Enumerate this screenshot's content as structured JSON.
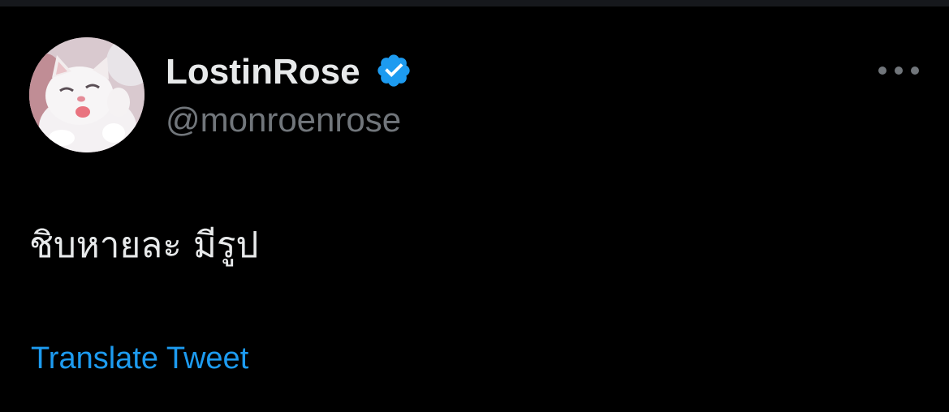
{
  "tweet": {
    "author": {
      "display_name": "LostinRose",
      "handle": "@monroenrose",
      "verified": true,
      "avatar": "kitten-avatar"
    },
    "text": "ชิบหายละ มีรูป",
    "translate_label": "Translate Tweet",
    "more_icon": "more-horizontal-icon"
  },
  "colors": {
    "background": "#000000",
    "primary_text": "#e7e9ea",
    "secondary_text": "#71767b",
    "accent": "#1d9bf0"
  }
}
